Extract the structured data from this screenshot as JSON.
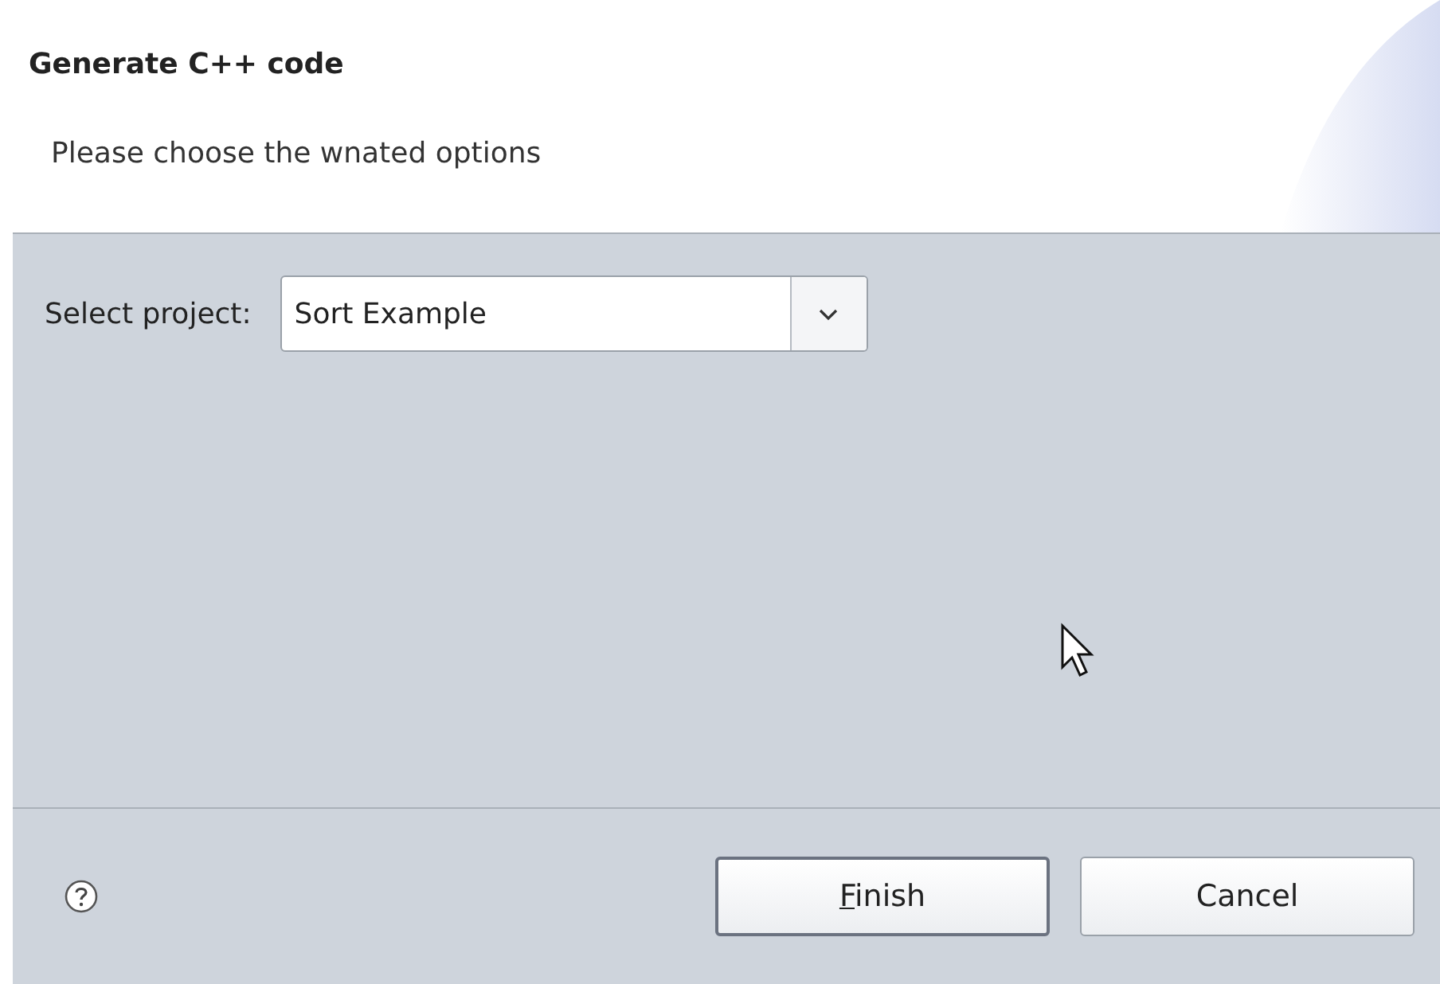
{
  "header": {
    "title": "Generate C++ code",
    "subtitle": "Please choose the wnated options"
  },
  "project": {
    "label": "Select project:",
    "value": "Sort Example"
  },
  "buttons": [
    {
      "label": "Finish",
      "first_letter_underlined": true,
      "default": true
    },
    {
      "label": "Cancel",
      "default": false
    }
  ]
}
